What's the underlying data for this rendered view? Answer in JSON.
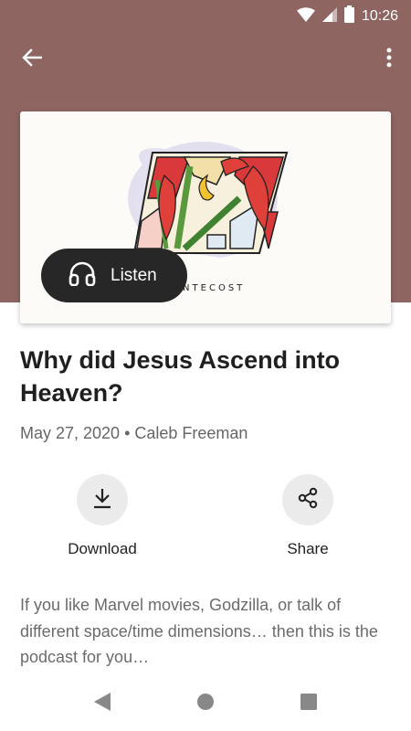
{
  "status_bar": {
    "time": "10:26"
  },
  "app_bar": {
    "back_icon": "arrow-back-icon",
    "menu_icon": "more-vert-icon"
  },
  "artwork": {
    "caption": "PENTECOST",
    "icon": "stained-glass-pentecost-artwork"
  },
  "listen_button": {
    "label": "Listen",
    "icon": "headphones-icon"
  },
  "episode": {
    "title": "Why did Jesus Ascend into Heaven?",
    "meta": "May 27, 2020 • Caleb Freeman",
    "description": "If you like Marvel movies, Godzilla, or talk of different space/time dimensions… then this is the podcast for you…"
  },
  "actions": [
    {
      "label": "Download",
      "icon": "download-icon"
    },
    {
      "label": "Share",
      "icon": "share-icon"
    }
  ],
  "nav_bar": {
    "icons": [
      "back-triangle-icon",
      "home-circle-icon",
      "recents-square-icon"
    ]
  },
  "colors": {
    "header": "#8e6561",
    "listen_button": "#272727",
    "action_circle": "#ebebeb"
  }
}
